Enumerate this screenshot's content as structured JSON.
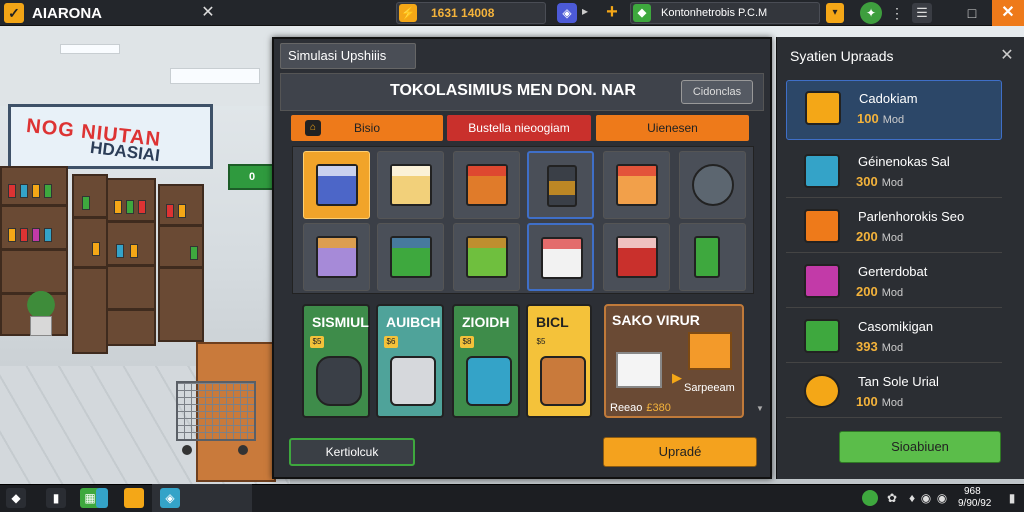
{
  "topbar": {
    "title": "AIARONA",
    "logo_icon": "checkmark-icon",
    "coin_value": "1631 14008",
    "cash_value": "Kontonhetrobis P.C.M"
  },
  "scene": {
    "sign_line1": "NOG NIUTAN",
    "sign_line2": "HDASIAI",
    "green_sign": "0"
  },
  "dialog": {
    "title": "Simulasi Upshiiis",
    "store_name": "TOKOLASIMIUS MEN DON. NAR",
    "header_button": "Cidonclas",
    "tabs": [
      {
        "label": "Bisio",
        "color": "#ee7a1a"
      },
      {
        "label": "Bustella nieoogiam",
        "color": "#c9302c"
      },
      {
        "label": "Uienesen",
        "color": "#ee7a1a"
      }
    ],
    "cards": [
      {
        "title": "SISMIUL",
        "badge": "$5"
      },
      {
        "title": "AUIBCH",
        "badge": "$6"
      },
      {
        "title": "ZIOIDH",
        "badge": "$8"
      },
      {
        "title": "BICL",
        "badge": "$5"
      }
    ],
    "feature": {
      "title": "SAKO VIRUR",
      "sub_label": "Sarpeeam",
      "price_label": "Reeao",
      "price_value": "£380"
    },
    "footer_left": "Kertiolcuk",
    "footer_right": "Upradé"
  },
  "side": {
    "title": "Syatien Upraads",
    "items": [
      {
        "name": "Cadokiam",
        "price": "100",
        "unit": "Mod",
        "icon_color": "#f4a717"
      },
      {
        "name": "Géinenokas Sal",
        "price": "300",
        "unit": "Mod",
        "icon_color": "#34a3c8"
      },
      {
        "name": "Parlenhorokis Seo",
        "price": "200",
        "unit": "Mod",
        "icon_color": "#ee7a1a"
      },
      {
        "name": "Gerterdobat",
        "price": "200",
        "unit": "Mod",
        "icon_color": "#c23aa8"
      },
      {
        "name": "Casomikigan",
        "price": "393",
        "unit": "Mod",
        "icon_color": "#3ea83e"
      },
      {
        "name": "Tan Sole Urial",
        "price": "100",
        "unit": "Mod",
        "icon_color": "#f4a717"
      }
    ],
    "button": "Sioabiuen"
  },
  "taskbar": {
    "time": "968",
    "date": "9/90/92"
  }
}
